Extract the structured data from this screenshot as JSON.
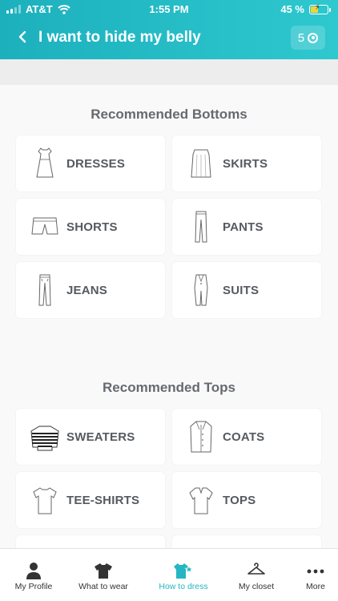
{
  "status_bar": {
    "carrier": "AT&T",
    "time": "1:55 PM",
    "battery_text": "45 %",
    "battery_level": 0.45
  },
  "nav": {
    "title": "I want to hide my belly",
    "count": "5"
  },
  "sections": [
    {
      "title": "Recommended Bottoms",
      "items": [
        {
          "label": "DRESSES",
          "icon": "dress-icon"
        },
        {
          "label": "SKIRTS",
          "icon": "skirt-icon"
        },
        {
          "label": "SHORTS",
          "icon": "shorts-icon"
        },
        {
          "label": "PANTS",
          "icon": "pants-icon"
        },
        {
          "label": "JEANS",
          "icon": "jeans-icon"
        },
        {
          "label": "SUITS",
          "icon": "suit-icon"
        }
      ]
    },
    {
      "title": "Recommended Tops",
      "items": [
        {
          "label": "SWEATERS",
          "icon": "sweater-icon"
        },
        {
          "label": "COATS",
          "icon": "coat-icon"
        },
        {
          "label": "TEE-SHIRTS",
          "icon": "tee-shirt-icon"
        },
        {
          "label": "TOPS",
          "icon": "top-icon"
        }
      ]
    }
  ],
  "tabbar": {
    "tabs": [
      {
        "label": "My Profile",
        "icon": "person-icon"
      },
      {
        "label": "What to wear",
        "icon": "shirt-icon"
      },
      {
        "label": "How to dress",
        "icon": "dress-star-icon"
      },
      {
        "label": "My closet",
        "icon": "hanger-icon"
      },
      {
        "label": "More",
        "icon": "more-icon"
      }
    ],
    "active_tab": "How to dress"
  },
  "colors": {
    "accent": "#24b6c2",
    "header_start": "#1cb0bd",
    "header_end": "#2ec8cf"
  }
}
